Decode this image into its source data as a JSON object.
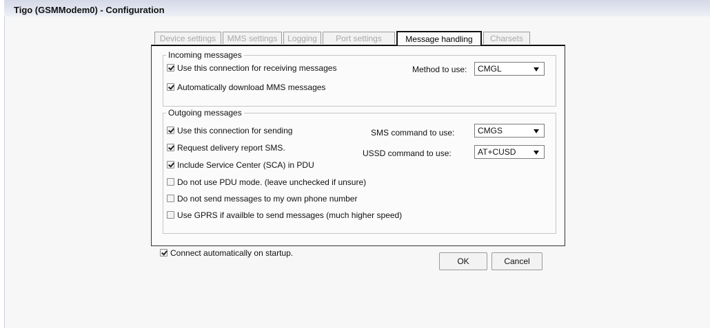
{
  "window": {
    "title": "Tigo (GSMModem0) - Configuration"
  },
  "tabs": [
    {
      "label": "Device settings",
      "active": false
    },
    {
      "label": "MMS settings",
      "active": false
    },
    {
      "label": "Logging",
      "active": false
    },
    {
      "label": "Port settings",
      "active": false
    },
    {
      "label": "Message handling",
      "active": true
    },
    {
      "label": "Charsets",
      "active": false
    }
  ],
  "incoming": {
    "legend": "Incoming messages",
    "receive_label": "Use this connection for receiving messages",
    "receive_checked": true,
    "auto_mms_label": "Automatically download MMS messages",
    "auto_mms_checked": true,
    "method_label": "Method to use:",
    "method_value": "CMGL"
  },
  "outgoing": {
    "legend": "Outgoing messages",
    "options": [
      {
        "label": "Use this connection for sending",
        "checked": true
      },
      {
        "label": "Request delivery report SMS.",
        "checked": true
      },
      {
        "label": "Include Service Center (SCA) in PDU",
        "checked": true
      },
      {
        "label": "Do not use PDU mode. (leave unchecked if unsure)",
        "checked": false
      },
      {
        "label": "Do not send messages to my own phone number",
        "checked": false
      },
      {
        "label": "Use GPRS if availble to send messages (much higher speed)",
        "checked": false
      }
    ],
    "sms_command_label": "SMS command to use:",
    "sms_command_value": "CMGS",
    "ussd_command_label": "USSD command to use:",
    "ussd_command_value": "AT+CUSD"
  },
  "startup": {
    "label": "Connect automatically on startup.",
    "checked": true
  },
  "buttons": {
    "ok": "OK",
    "cancel": "Cancel"
  },
  "icons": {
    "dropdown": "chevron-down-icon",
    "checkbox": "checkbox-icon"
  }
}
